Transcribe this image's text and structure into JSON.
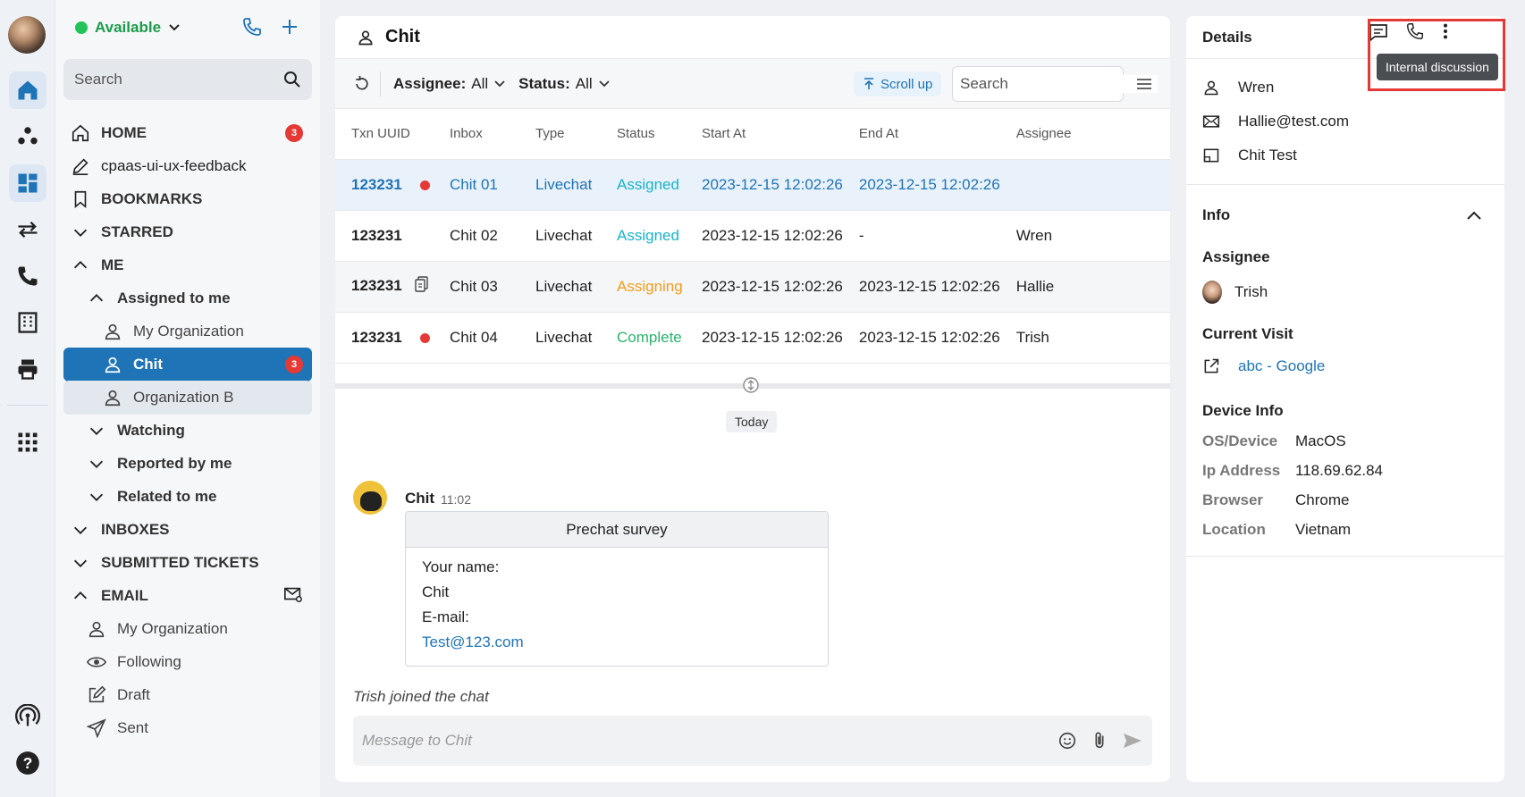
{
  "app": {
    "brand_color": "#1f73b7",
    "alert_color": "#e53935"
  },
  "sidebar": {
    "status": "Available",
    "search_placeholder": "Search",
    "items": [
      {
        "label": "HOME",
        "badge": "3"
      },
      {
        "label": "cpaas-ui-ux-feedback"
      },
      {
        "label": "BOOKMARKS"
      },
      {
        "label": "STARRED"
      },
      {
        "label": "ME"
      },
      {
        "label": "Assigned to me"
      },
      {
        "label": "My Organization"
      },
      {
        "label": "Chit",
        "badge": "3"
      },
      {
        "label": "Organization B"
      },
      {
        "label": "Watching"
      },
      {
        "label": "Reported by me"
      },
      {
        "label": "Related to me"
      },
      {
        "label": "INBOXES"
      },
      {
        "label": "SUBMITTED TICKETS"
      },
      {
        "label": "EMAIL"
      },
      {
        "label": "My Organization"
      },
      {
        "label": "Following"
      },
      {
        "label": "Draft"
      },
      {
        "label": "Sent"
      }
    ]
  },
  "main": {
    "title": "Chit",
    "toolbar": {
      "assignee_label": "Assignee:",
      "assignee_value": "All",
      "status_label": "Status:",
      "status_value": "All",
      "scroll_up": "Scroll up",
      "search_placeholder": "Search"
    },
    "table": {
      "columns": [
        "Txn UUID",
        "Inbox",
        "Type",
        "Status",
        "Start At",
        "End At",
        "Assignee"
      ],
      "rows": [
        {
          "uuid": "123231",
          "inbox": "Chit 01",
          "type": "Livechat",
          "status": "Assigned",
          "start": "2023-12-15 12:02:26",
          "end": "2023-12-15 12:02:26",
          "assignee": ""
        },
        {
          "uuid": "123231",
          "inbox": "Chit 02",
          "type": "Livechat",
          "status": "Assigned",
          "start": "2023-12-15 12:02:26",
          "end": "-",
          "assignee": "Wren"
        },
        {
          "uuid": "123231",
          "inbox": "Chit 03",
          "type": "Livechat",
          "status": "Assigning",
          "start": "2023-12-15 12:02:26",
          "end": "2023-12-15 12:02:26",
          "assignee": "Hallie"
        },
        {
          "uuid": "123231",
          "inbox": "Chit 04",
          "type": "Livechat",
          "status": "Complete",
          "start": "2023-12-15 12:02:26",
          "end": "2023-12-15 12:02:26",
          "assignee": "Trish"
        }
      ]
    },
    "chat": {
      "date_divider": "Today",
      "sender": "Chit",
      "time": "11:02",
      "card_title": "Prechat survey",
      "card_lines": [
        "Your name:",
        "Chit",
        "E-mail:"
      ],
      "card_email": "Test@123.com",
      "system_msg": "Trish joined the chat",
      "composer_placeholder": "Message to Chit"
    }
  },
  "details": {
    "title": "Details",
    "tooltip": "Internal discussion",
    "name": "Wren",
    "email": "Hallie@test.com",
    "source": "Chit Test",
    "info_title": "Info",
    "assignee_title": "Assignee",
    "assignee_name": "Trish",
    "visit_title": "Current Visit",
    "visit_link": "abc - Google",
    "device_title": "Device Info",
    "device": [
      {
        "k": "OS/Device",
        "v": "MacOS"
      },
      {
        "k": "Ip Address",
        "v": "118.69.62.84"
      },
      {
        "k": "Browser",
        "v": "Chrome"
      },
      {
        "k": "Location",
        "v": "Vietnam"
      }
    ]
  }
}
